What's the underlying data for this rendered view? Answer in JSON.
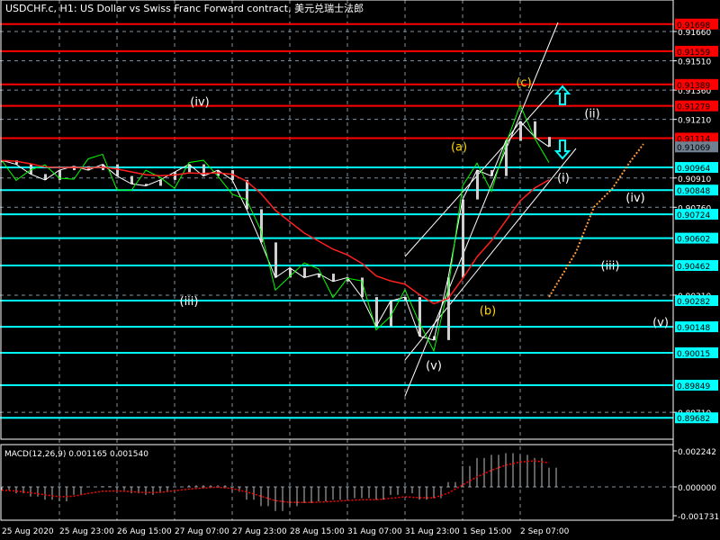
{
  "chart_data": {
    "type": "line",
    "title": "USDCHF.c, H1:  US Dollar vs Swiss Franc Forward contract, 美元兑瑞士法郎",
    "x_step_hours": 4,
    "close": [
      0.91,
      0.9098,
      0.9093,
      0.909,
      0.9095,
      0.9097,
      0.9095,
      0.9098,
      0.9092,
      0.9088,
      0.9087,
      0.909,
      0.9094,
      0.9098,
      0.9092,
      0.9095,
      0.909,
      0.9075,
      0.9058,
      0.904,
      0.9045,
      0.904,
      0.9042,
      0.9038,
      0.904,
      0.903,
      0.9015,
      0.9028,
      0.903,
      0.901,
      0.9008,
      0.904,
      0.908,
      0.9095,
      0.9092,
      0.911,
      0.912,
      0.9112,
      0.9107
    ],
    "ylim": [
      0.896,
      0.918
    ],
    "y_ticks": [
      "0.91660",
      "0.91510",
      "0.91360",
      "0.91210",
      "0.90910",
      "0.90760",
      "0.90310",
      "0.89710"
    ],
    "x_ticks": [
      "25 Aug 2020",
      "25 Aug 23:00",
      "26 Aug 15:00",
      "27 Aug 07:00",
      "27 Aug 23:00",
      "28 Aug 15:00",
      "31 Aug 07:00",
      "31 Aug 23:00",
      "1 Sep 15:00",
      "2 Sep 07:00"
    ],
    "resistance_levels": [
      "0.91698",
      "0.91559",
      "0.91389",
      "0.91279",
      "0.91114"
    ],
    "support_levels": [
      "0.90964",
      "0.90848",
      "0.90724",
      "0.90602",
      "0.90462",
      "0.90282",
      "0.90148",
      "0.90015",
      "0.89849",
      "0.89682"
    ],
    "current_price": "0.91069",
    "wave_labels": [
      {
        "text": "(iv)",
        "price": 0.9128,
        "bar": 55,
        "color": "#ffffff"
      },
      {
        "text": "(iii)",
        "price": 0.9026,
        "bar": 52,
        "color": "#ffffff"
      },
      {
        "text": "(v)",
        "price": 0.8993,
        "bar": 120,
        "color": "#ffffff"
      },
      {
        "text": "(a)",
        "price": 0.9105,
        "bar": 127,
        "color": "#ffd700"
      },
      {
        "text": "(b)",
        "price": 0.9021,
        "bar": 135,
        "color": "#ffd700"
      },
      {
        "text": "(c)",
        "price": 0.9138,
        "bar": 145,
        "color": "#ffd700"
      },
      {
        "text": "(ii)",
        "price": 0.9122,
        "bar": 164,
        "color": "#ffffff"
      },
      {
        "text": "(i)",
        "price": 0.9089,
        "bar": 156,
        "color": "#ffffff"
      },
      {
        "text": "(iv)",
        "price": 0.9079,
        "bar": 176,
        "color": "#ffffff"
      },
      {
        "text": "(iii)",
        "price": 0.9044,
        "bar": 169,
        "color": "#ffffff"
      },
      {
        "text": "(v)",
        "price": 0.9015,
        "bar": 183,
        "color": "#ffffff"
      }
    ],
    "macd": {
      "label": "MACD(12,26,9) 0.001165 0.001540",
      "y_ticks": [
        "0.002242",
        "0.000000",
        "-0.001731"
      ],
      "ylim": [
        -0.001731,
        0.002242
      ],
      "histogram_e3": [
        -0.2,
        -0.4,
        -0.6,
        -0.8,
        -0.9,
        -0.5,
        0,
        0.05,
        -0.2,
        -0.4,
        -0.5,
        -0.3,
        0,
        0.1,
        0.1,
        0.1,
        -0.3,
        -0.8,
        -1.2,
        -1.5,
        -1.2,
        -1.0,
        -0.9,
        -0.8,
        -0.7,
        -0.7,
        -0.8,
        -0.5,
        -0.4,
        -0.8,
        -0.7,
        0.3,
        1.3,
        1.8,
        2.0,
        2.1,
        2.0,
        1.8,
        1.2
      ]
    },
    "colors": {
      "resistance": "#ff0000",
      "support": "#00ffff",
      "price": "#ffffff",
      "green": "#00ff00",
      "ma": "#ff2020",
      "grid": "#8090a0"
    }
  }
}
